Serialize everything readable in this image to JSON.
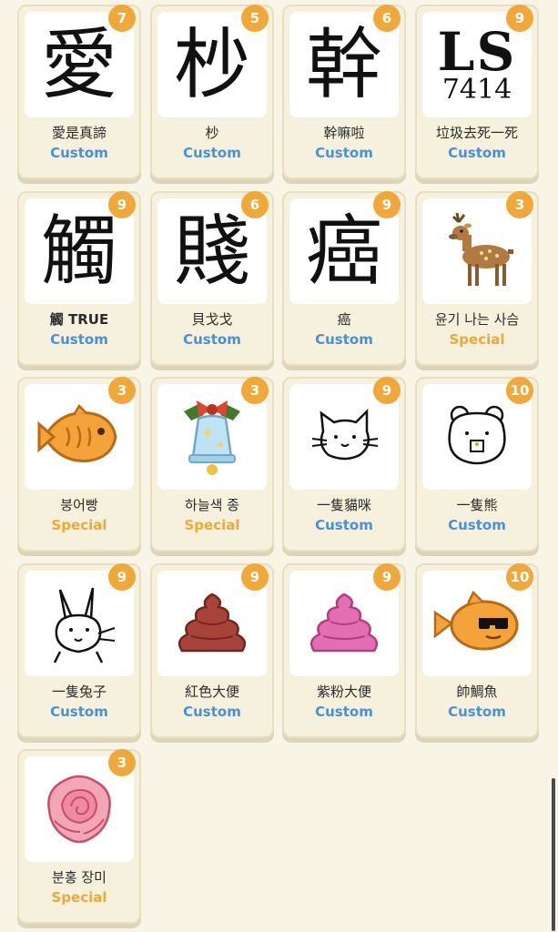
{
  "items": [
    {
      "name": "愛是真諦",
      "tier": "Custom",
      "badge": "7",
      "icon": "char-ai-icon",
      "glyph": "愛"
    },
    {
      "name": "杪",
      "tier": "Custom",
      "badge": "5",
      "icon": "char-miao-icon",
      "glyph": "杪"
    },
    {
      "name": "幹嘛啦",
      "tier": "Custom",
      "badge": "6",
      "icon": "char-gan-icon",
      "glyph": "幹"
    },
    {
      "name": "垃圾去死一死",
      "tier": "Custom",
      "badge": "9",
      "icon": "ls-7414-icon",
      "glyph_top": "LS",
      "glyph_bottom": "7414"
    },
    {
      "name": "觸 TRUE",
      "tier": "Custom",
      "badge": "9",
      "icon": "char-chu-icon",
      "glyph": "觸"
    },
    {
      "name": "貝戈戈",
      "tier": "Custom",
      "badge": "6",
      "icon": "char-jian-icon",
      "glyph": "賤"
    },
    {
      "name": "癌",
      "tier": "Custom",
      "badge": "9",
      "icon": "char-ai-cancer-icon",
      "glyph": "癌"
    },
    {
      "name": "윤기 나는 사슴",
      "tier": "Special",
      "badge": "3",
      "icon": "deer-icon"
    },
    {
      "name": "붕어빵",
      "tier": "Special",
      "badge": "3",
      "icon": "fish-bread-icon"
    },
    {
      "name": "하늘색 종",
      "tier": "Special",
      "badge": "3",
      "icon": "sky-blue-bell-icon"
    },
    {
      "name": "一隻貓咪",
      "tier": "Custom",
      "badge": "9",
      "icon": "cat-sketch-icon"
    },
    {
      "name": "一隻熊",
      "tier": "Custom",
      "badge": "10",
      "icon": "bear-sketch-icon"
    },
    {
      "name": "一隻兔子",
      "tier": "Custom",
      "badge": "9",
      "icon": "rabbit-sketch-icon"
    },
    {
      "name": "紅色大便",
      "tier": "Custom",
      "badge": "9",
      "icon": "brown-poop-icon"
    },
    {
      "name": "紫粉大便",
      "tier": "Custom",
      "badge": "9",
      "icon": "pink-poop-icon"
    },
    {
      "name": "帥鯛魚",
      "tier": "Custom",
      "badge": "10",
      "icon": "cool-fish-bread-icon"
    },
    {
      "name": "분홍 장미",
      "tier": "Special",
      "badge": "3",
      "icon": "pink-rose-icon"
    }
  ],
  "colors": {
    "background": "#f8f5e6",
    "badge": "#f0a83a",
    "custom": "#4a90d9",
    "special": "#eba93a"
  }
}
